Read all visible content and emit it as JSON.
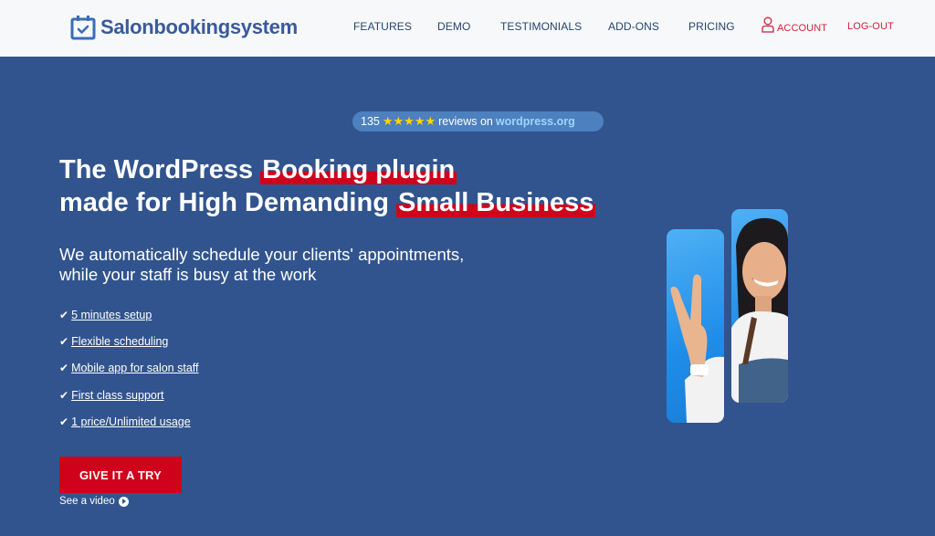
{
  "header": {
    "logo_text": "Salonbookingsystem",
    "nav": [
      {
        "label": "FEATURES"
      },
      {
        "label": "DEMO"
      },
      {
        "label": "TESTIMONIALS"
      },
      {
        "label": "ADD-ONS"
      },
      {
        "label": "PRICING"
      }
    ],
    "account_label": "ACCOUNT",
    "logout_label": "LOG-OUT"
  },
  "rating": {
    "count": "135",
    "stars": "★★★★★",
    "text": "reviews on",
    "site": "wordpress.org"
  },
  "hero": {
    "line1_plain": "The WordPress ",
    "line1_highlight": "Booking plugin",
    "line2_plain": "made for High Demanding ",
    "line2_highlight": "Small Business",
    "sub_line1": "We automatically schedule your clients' appointments,",
    "sub_line2": "while your staff is busy at the work",
    "features": [
      " 5 minutes setup",
      " Flexible scheduling",
      " Mobile app for salon staff",
      " First class support",
      " 1 price/Unlimited usage"
    ],
    "cta_label": "GIVE IT A TRY",
    "video_label": "See a video"
  },
  "colors": {
    "background": "#31548e",
    "accent_red": "#d0021b",
    "header_bg": "#f7f8fa"
  }
}
